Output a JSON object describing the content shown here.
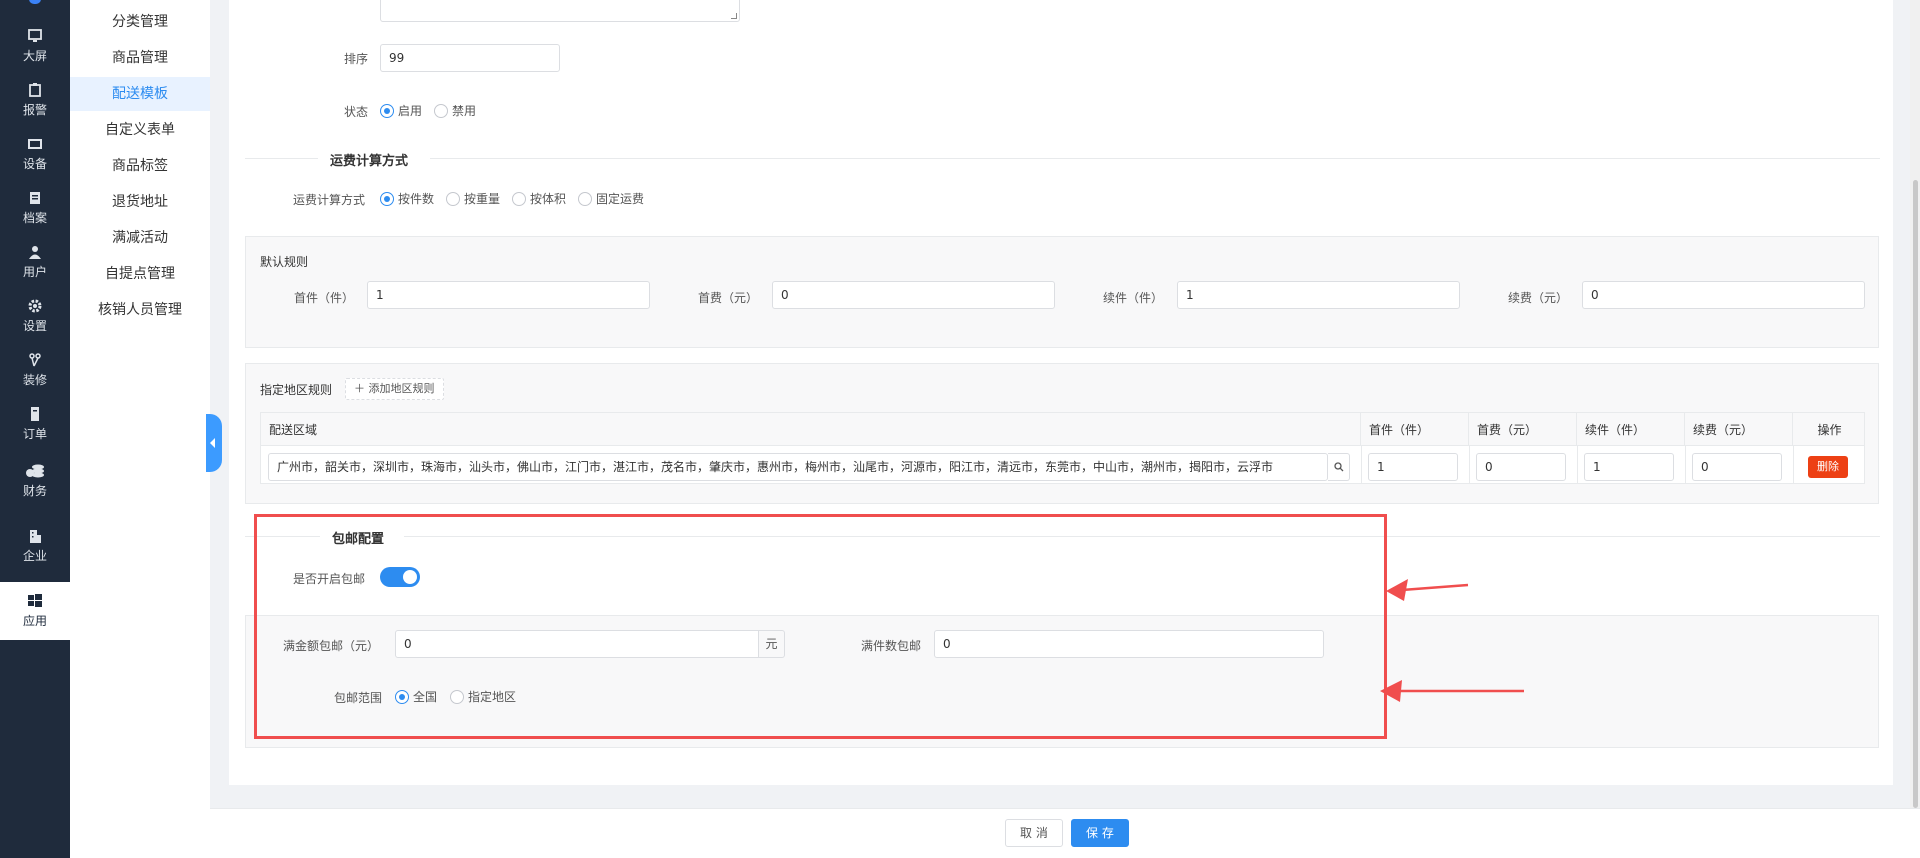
{
  "nav_rail": [
    {
      "label": "大屏",
      "icon": "monitor-icon"
    },
    {
      "label": "报警",
      "icon": "clipboard-icon"
    },
    {
      "label": "设备",
      "icon": "device-icon"
    },
    {
      "label": "档案",
      "icon": "file-icon"
    },
    {
      "label": "用户",
      "icon": "user-icon"
    },
    {
      "label": "设置",
      "icon": "gear-icon"
    },
    {
      "label": "装修",
      "icon": "brush-icon"
    },
    {
      "label": "订单",
      "icon": "order-icon"
    },
    {
      "label": "财务",
      "icon": "coins-icon"
    },
    {
      "label": "企业",
      "icon": "building-icon"
    },
    {
      "label": "应用",
      "icon": "windows-icon"
    }
  ],
  "submenu": [
    "分类管理",
    "商品管理",
    "配送模板",
    "自定义表单",
    "商品标签",
    "退货地址",
    "满减活动",
    "自提点管理",
    "核销人员管理"
  ],
  "form": {
    "sort_label": "排序",
    "sort_value": "99",
    "status_label": "状态",
    "status_options": [
      "启用",
      "禁用"
    ],
    "status_selected": "启用"
  },
  "shipping_calc": {
    "section_title": "运费计算方式",
    "method_label": "运费计算方式",
    "options": [
      "按件数",
      "按重量",
      "按体积",
      "固定运费"
    ],
    "selected": "按件数"
  },
  "default_rule": {
    "title": "默认规则",
    "fields": [
      {
        "label": "首件（件）",
        "value": "1"
      },
      {
        "label": "首费（元）",
        "value": "0"
      },
      {
        "label": "续件（件）",
        "value": "1"
      },
      {
        "label": "续费（元）",
        "value": "0"
      }
    ]
  },
  "region_rule": {
    "title": "指定地区规则",
    "add_button": "添加地区规则",
    "columns": [
      "配送区域",
      "首件（件）",
      "首费（元）",
      "续件（件）",
      "续费（元）",
      "操作"
    ],
    "rows": [
      {
        "region": "广州市，韶关市，深圳市，珠海市，汕头市，佛山市，江门市，湛江市，茂名市，肇庆市，惠州市，梅州市，汕尾市，河源市，阳江市，清远市，东莞市，中山市，潮州市，揭阳市，云浮市",
        "first_count": "1",
        "first_fee": "0",
        "next_count": "1",
        "next_fee": "0",
        "delete_label": "删除"
      }
    ]
  },
  "free_shipping": {
    "section_title": "包邮配置",
    "enable_label": "是否开启包邮",
    "enabled": true,
    "amount_label": "满金额包邮（元）",
    "amount_value": "0",
    "amount_suffix": "元",
    "count_label": "满件数包邮",
    "count_value": "0",
    "scope_label": "包邮范围",
    "scope_options": [
      "全国",
      "指定地区"
    ],
    "scope_selected": "全国"
  },
  "footer": {
    "cancel": "取 消",
    "save": "保 存"
  },
  "colors": {
    "primary": "#2d8cf0",
    "danger": "#ed4014",
    "highlight": "#f04e4e",
    "rail_bg": "#1f2b3c"
  }
}
